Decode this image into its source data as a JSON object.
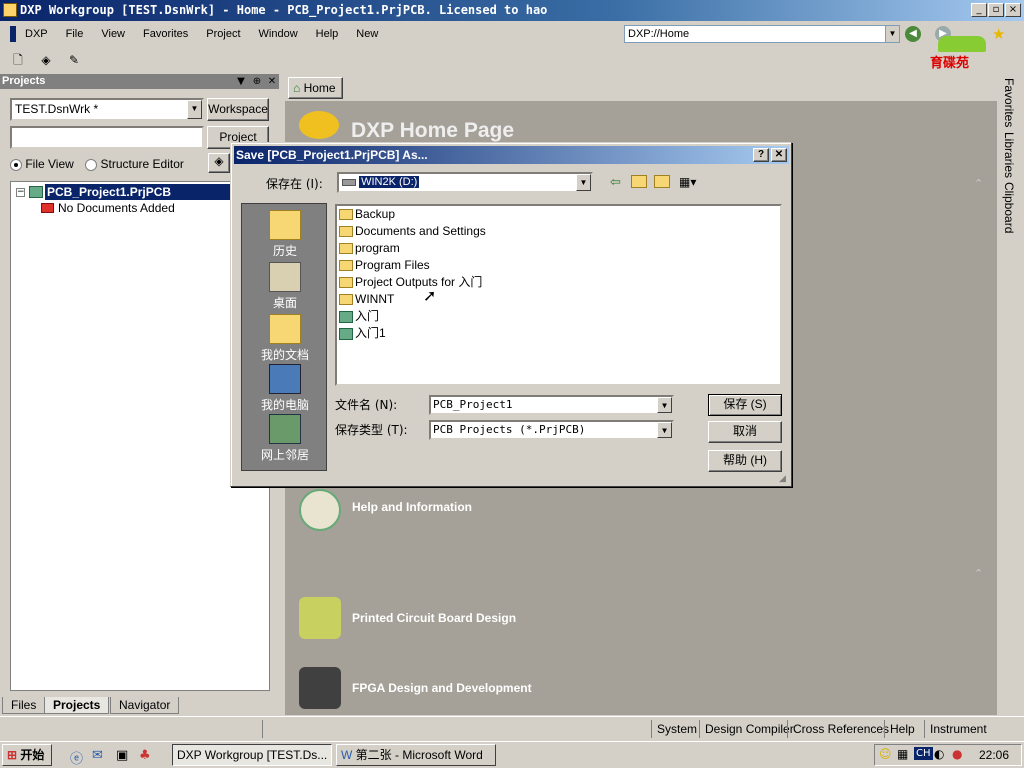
{
  "window": {
    "title": "DXP Workgroup [TEST.DsnWrk] - Home - PCB_Project1.PrjPCB. Licensed to hao"
  },
  "menu": {
    "items": [
      "DXP",
      "File",
      "View",
      "Favorites",
      "Project",
      "Window",
      "Help",
      "New"
    ]
  },
  "address": {
    "value": "DXP://Home"
  },
  "logo": {
    "text": "育碟苑"
  },
  "projects_panel": {
    "title": "Projects",
    "workspace_combo": "TEST.DsnWrk *",
    "workspace_button": "Workspace",
    "project_button": "Project",
    "file_view_label": "File View",
    "structure_editor_label": "Structure Editor",
    "tree": {
      "project": "PCB_Project1.PrjPCB",
      "child": "No Documents Added"
    },
    "tabs": [
      "Files",
      "Projects",
      "Navigator"
    ]
  },
  "home": {
    "tab_label": "Home",
    "page_title": "DXP Home Page",
    "links": [
      "Help and Information",
      "Printed Circuit Board Design",
      "FPGA Design and Development"
    ]
  },
  "right_tabs": [
    "Favorites",
    "Libraries",
    "Clipboard"
  ],
  "dialog": {
    "title": "Save [PCB_Project1.PrjPCB] As...",
    "save_in_label": "保存在 (I):",
    "save_in_value": "WIN2K (D:)",
    "places": [
      "历史",
      "桌面",
      "我的文档",
      "我的电脑",
      "网上邻居"
    ],
    "files": [
      {
        "name": "Backup",
        "type": "folder"
      },
      {
        "name": "Documents and Settings",
        "type": "folder"
      },
      {
        "name": "program",
        "type": "folder"
      },
      {
        "name": "Program Files",
        "type": "folder"
      },
      {
        "name": "Project Outputs for 入门",
        "type": "folder"
      },
      {
        "name": "WINNT",
        "type": "folder"
      },
      {
        "name": "入门",
        "type": "project"
      },
      {
        "name": "入门1",
        "type": "project"
      }
    ],
    "filename_label": "文件名 (N):",
    "filename_value": "PCB_Project1",
    "filetype_label": "保存类型 (T):",
    "filetype_value": "PCB Projects (*.PrjPCB)",
    "save_button": "保存 (S)",
    "cancel_button": "取消",
    "help_button": "帮助 (H)"
  },
  "statusbar": {
    "items": [
      "System",
      "Design Compiler",
      "Cross References",
      "Help",
      "Instrument Racks"
    ]
  },
  "taskbar": {
    "start": "开始",
    "tasks": [
      "DXP Workgroup [TEST.Ds...",
      "第二张 - Microsoft Word"
    ],
    "tray_lang": "CH",
    "clock": "22:06"
  }
}
